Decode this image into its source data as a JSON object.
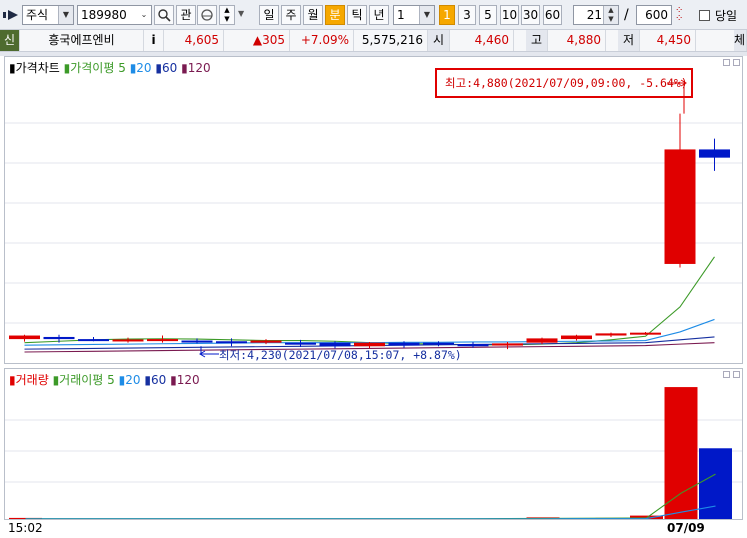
{
  "toolbar": {
    "market": "주식",
    "code": "189980",
    "watch_label": "관",
    "period_buttons": [
      "일",
      "주",
      "월",
      "분",
      "틱",
      "년"
    ],
    "active_period": "분",
    "interval_value": "1",
    "interval_buttons": [
      "1",
      "3",
      "5",
      "10",
      "30",
      "60"
    ],
    "active_interval": "1",
    "count_value": "21",
    "divider": "/",
    "total_value": "600",
    "same_day_label": "당일"
  },
  "info": {
    "badge": "신",
    "name": "흥국에프엔비",
    "info_btn": "i",
    "price": "4,605",
    "change": "▲305",
    "change_pct": "+7.09%",
    "volume": "5,575,216",
    "open_label": "시",
    "open": "4,460",
    "high_label": "고",
    "high": "4,880",
    "low_label": "저",
    "low": "4,450",
    "exec_label": "체결강"
  },
  "price_pane": {
    "title": "가격차트",
    "ma_title": "가격이평",
    "ma_periods": [
      "5",
      "20",
      "60",
      "120"
    ],
    "high_note": "최고:4,880(2021/07/09,09:00, -5.64%)",
    "low_note": "최저:4,230(2021/07/08,15:07, +8.87%)"
  },
  "volume_pane": {
    "title": "거래량",
    "ma_title": "거래이평",
    "ma_periods": [
      "5",
      "20",
      "60",
      "120"
    ]
  },
  "x_axis": {
    "start_label": "15:02",
    "date_label": "07/09"
  },
  "colors": {
    "up": "#e00000",
    "down": "#0018c8",
    "ma5": "#3c9a28",
    "ma20": "#1e8ce6",
    "ma60": "#1630a0",
    "ma120": "#7a1a50",
    "grid": "#e3e6ec",
    "annotation_box": "#e00000"
  },
  "chart_data": [
    {
      "type": "candlestick",
      "title": "가격차트",
      "ylim": [
        4200,
        4960
      ],
      "candles": [
        {
          "o": 4250,
          "h": 4262,
          "l": 4243,
          "c": 4260
        },
        {
          "o": 4256,
          "h": 4262,
          "l": 4240,
          "c": 4250
        },
        {
          "o": 4250,
          "h": 4256,
          "l": 4244,
          "c": 4247
        },
        {
          "o": 4246,
          "h": 4254,
          "l": 4240,
          "c": 4249
        },
        {
          "o": 4246,
          "h": 4260,
          "l": 4240,
          "c": 4250
        },
        {
          "o": 4246,
          "h": 4252,
          "l": 4238,
          "c": 4244
        },
        {
          "o": 4244,
          "h": 4252,
          "l": 4230,
          "c": 4240
        },
        {
          "o": 4240,
          "h": 4250,
          "l": 4236,
          "c": 4246
        },
        {
          "o": 4240,
          "h": 4248,
          "l": 4228,
          "c": 4236
        },
        {
          "o": 4240,
          "h": 4244,
          "l": 4224,
          "c": 4230
        },
        {
          "o": 4230,
          "h": 4242,
          "l": 4224,
          "c": 4240
        },
        {
          "o": 4240,
          "h": 4244,
          "l": 4226,
          "c": 4232
        },
        {
          "o": 4240,
          "h": 4244,
          "l": 4230,
          "c": 4236
        },
        {
          "o": 4236,
          "h": 4242,
          "l": 4226,
          "c": 4230
        },
        {
          "o": 4232,
          "h": 4242,
          "l": 4222,
          "c": 4238
        },
        {
          "o": 4240,
          "h": 4254,
          "l": 4236,
          "c": 4252
        },
        {
          "o": 4250,
          "h": 4262,
          "l": 4246,
          "c": 4260
        },
        {
          "o": 4260,
          "h": 4268,
          "l": 4256,
          "c": 4266
        },
        {
          "o": 4266,
          "h": 4270,
          "l": 4262,
          "c": 4268
        },
        {
          "o": 4460,
          "h": 4880,
          "l": 4450,
          "c": 4780
        },
        {
          "o": 4780,
          "h": 4810,
          "l": 4720,
          "c": 4757
        }
      ],
      "ma": {
        "5": [
          4240,
          4244,
          4248,
          4250,
          4251,
          4250,
          4248,
          4246,
          4246,
          4244,
          4240,
          4238,
          4236,
          4234,
          4234,
          4236,
          4240,
          4248,
          4258,
          4340,
          4480
        ],
        "20": [
          4233,
          4234,
          4235,
          4236,
          4237,
          4238,
          4239,
          4240,
          4240,
          4240,
          4240,
          4241,
          4241,
          4242,
          4242,
          4243,
          4244,
          4245,
          4246,
          4270,
          4305
        ],
        "60": [
          4222,
          4223,
          4224,
          4225,
          4226,
          4227,
          4228,
          4229,
          4230,
          4231,
          4232,
          4233,
          4234,
          4235,
          4236,
          4237,
          4238,
          4239,
          4240,
          4248,
          4256
        ],
        "120": [
          4214,
          4215,
          4216,
          4217,
          4218,
          4219,
          4220,
          4221,
          4222,
          4223,
          4224,
          4225,
          4226,
          4227,
          4228,
          4229,
          4230,
          4231,
          4232,
          4236,
          4240
        ]
      }
    },
    {
      "type": "bar",
      "title": "거래량",
      "ylim": [
        0,
        1000
      ],
      "values": [
        8,
        0,
        0,
        0,
        0,
        0,
        0,
        0,
        0,
        0,
        0,
        0,
        0,
        0,
        0,
        12,
        6,
        8,
        25,
        970,
        520
      ],
      "colors": [
        "up",
        "up",
        "up",
        "up",
        "up",
        "up",
        "up",
        "up",
        "up",
        "up",
        "up",
        "up",
        "up",
        "up",
        "up",
        "up",
        "up",
        "up",
        "up",
        "up",
        "down"
      ],
      "ma": {
        "5": [
          2,
          2,
          2,
          2,
          2,
          2,
          2,
          2,
          2,
          2,
          2,
          2,
          2,
          2,
          3,
          4,
          5,
          6,
          8,
          190,
          330
        ],
        "20": [
          1,
          1,
          1,
          1,
          1,
          1,
          1,
          1,
          1,
          1,
          1,
          1,
          1,
          1,
          1,
          1,
          2,
          2,
          3,
          50,
          95
        ]
      }
    }
  ]
}
